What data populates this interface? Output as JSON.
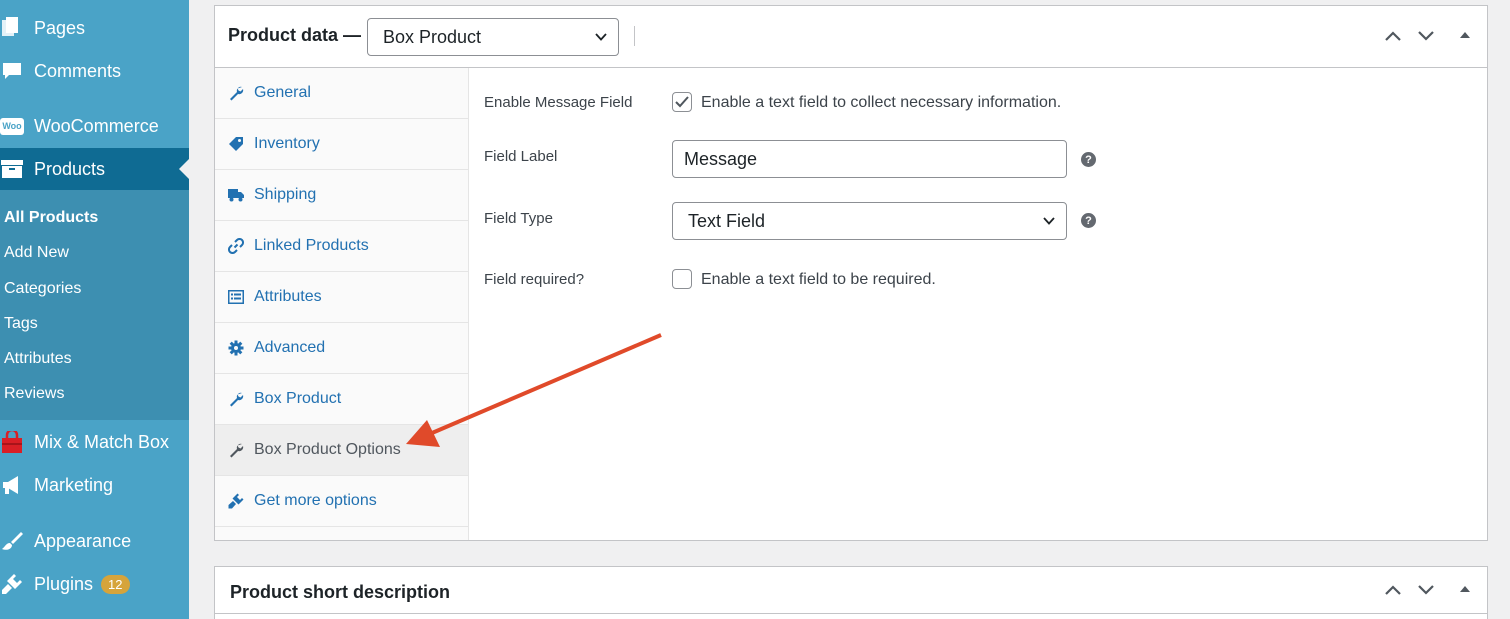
{
  "sidebar": {
    "items": [
      {
        "label": "Pages",
        "icon": "pages-icon"
      },
      {
        "label": "Comments",
        "icon": "comments-icon"
      },
      {
        "label": "WooCommerce",
        "icon": "woocommerce-icon",
        "icon_text": "Woo"
      },
      {
        "label": "Products",
        "icon": "archive-icon"
      },
      {
        "label": "Mix & Match Box",
        "icon": "shopping-bag-icon"
      },
      {
        "label": "Marketing",
        "icon": "megaphone-icon"
      },
      {
        "label": "Appearance",
        "icon": "brush-icon"
      },
      {
        "label": "Plugins",
        "icon": "plugin-icon",
        "badge": "12"
      }
    ],
    "submenu": [
      "All Products",
      "Add New",
      "Categories",
      "Tags",
      "Attributes",
      "Reviews"
    ]
  },
  "product_data": {
    "title": "Product data —",
    "type_selected": "Box Product"
  },
  "tabs": [
    {
      "label": "General",
      "icon": "wrench-icon"
    },
    {
      "label": "Inventory",
      "icon": "tag-icon"
    },
    {
      "label": "Shipping",
      "icon": "truck-icon"
    },
    {
      "label": "Linked Products",
      "icon": "link-icon"
    },
    {
      "label": "Attributes",
      "icon": "list-icon"
    },
    {
      "label": "Advanced",
      "icon": "gear-icon"
    },
    {
      "label": "Box Product",
      "icon": "wrench-icon"
    },
    {
      "label": "Box Product Options",
      "icon": "wrench-icon"
    },
    {
      "label": "Get more options",
      "icon": "plugin-icon"
    }
  ],
  "options": {
    "enable_message": {
      "label": "Enable Message Field",
      "checkbox_text": "Enable a text field to collect necessary information.",
      "checked": true
    },
    "field_label": {
      "label": "Field Label",
      "value": "Message"
    },
    "field_type": {
      "label": "Field Type",
      "value": "Text Field"
    },
    "field_required": {
      "label": "Field required?",
      "checkbox_text": "Enable a text field to be required.",
      "checked": false
    },
    "help_glyph": "?"
  },
  "short_description": {
    "title": "Product short description"
  },
  "colors": {
    "sidebar_bg": "#4aa3c7",
    "sidebar_current": "#0f6b93",
    "link": "#2271b1",
    "annotation_arrow": "#e04a2a",
    "badge": "#d6a43b"
  }
}
